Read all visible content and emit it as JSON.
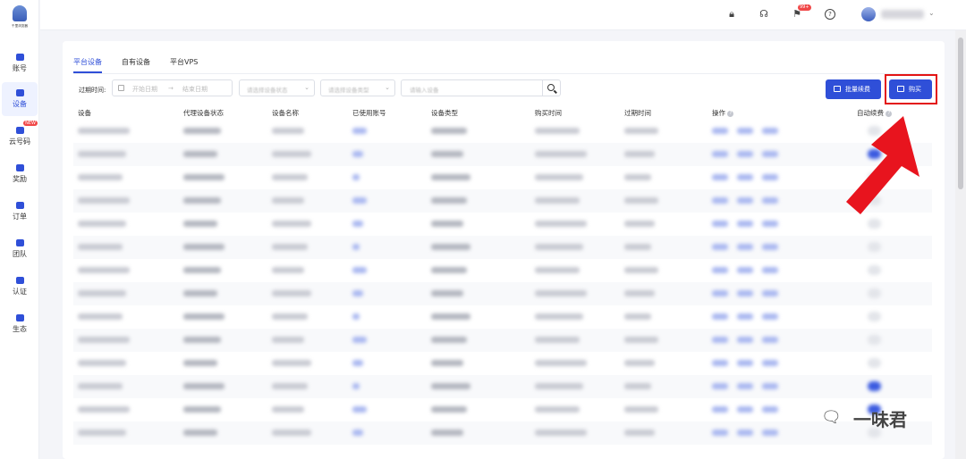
{
  "brand": {
    "name": "千里浏览器"
  },
  "sidebar": {
    "items": [
      {
        "label": "账号",
        "icon": "account-icon"
      },
      {
        "label": "设备",
        "icon": "device-icon",
        "active": true
      },
      {
        "label": "云号码",
        "icon": "cloud-number-icon",
        "badge": "NEW"
      },
      {
        "label": "奖励",
        "icon": "reward-icon"
      },
      {
        "label": "订单",
        "icon": "order-icon"
      },
      {
        "label": "团队",
        "icon": "team-icon"
      },
      {
        "label": "认证",
        "icon": "certification-icon"
      },
      {
        "label": "生态",
        "icon": "ecosystem-icon"
      }
    ]
  },
  "topbar": {
    "notification_badge": "99+",
    "icons": [
      "lock-icon",
      "headset-icon",
      "bell-icon",
      "help-icon"
    ]
  },
  "tabs": [
    {
      "label": "平台设备",
      "active": true
    },
    {
      "label": "自有设备"
    },
    {
      "label": "平台VPS"
    }
  ],
  "filters": {
    "expiry_label": "过期时间:",
    "date_start_placeholder": "开始日期",
    "date_separator": "→",
    "date_end_placeholder": "结束日期",
    "status_placeholder": "请选择设备状态",
    "type_placeholder": "请选择设备类型",
    "search_placeholder": "请输入设备"
  },
  "actions": {
    "batch_renew": "批量续费",
    "buy": "购买"
  },
  "table": {
    "columns": [
      "设备",
      "代理设备状态",
      "设备名称",
      "已使用账号",
      "设备类型",
      "购买时间",
      "过期时间",
      "操作",
      "自动续费"
    ],
    "row_count": 14,
    "toggles_on_rows": [
      1,
      11,
      12
    ]
  },
  "watermark": {
    "text": "一味君"
  },
  "colors": {
    "primary": "#2f4fd8",
    "highlight": "#e31414",
    "badge": "#f04747"
  }
}
